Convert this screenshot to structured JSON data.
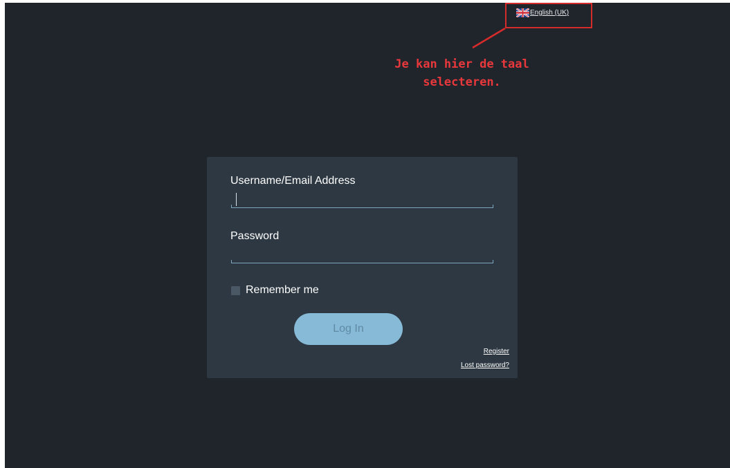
{
  "language": {
    "current": "English (UK)",
    "flag_icon": "uk-flag-icon"
  },
  "annotation": {
    "line1": "Je kan hier de taal",
    "line2": "selecteren.",
    "color": "#e8383c"
  },
  "login": {
    "username_label": "Username/Email Address",
    "username_value": "",
    "password_label": "Password",
    "password_value": "",
    "remember_label": "Remember me",
    "remember_checked": false,
    "submit_label": "Log In",
    "register_link": "Register",
    "lost_password_link": "Lost password?"
  },
  "colors": {
    "background": "#20252b",
    "panel": "#2d3842",
    "button": "#86bad6",
    "highlight": "#d62b2b"
  }
}
